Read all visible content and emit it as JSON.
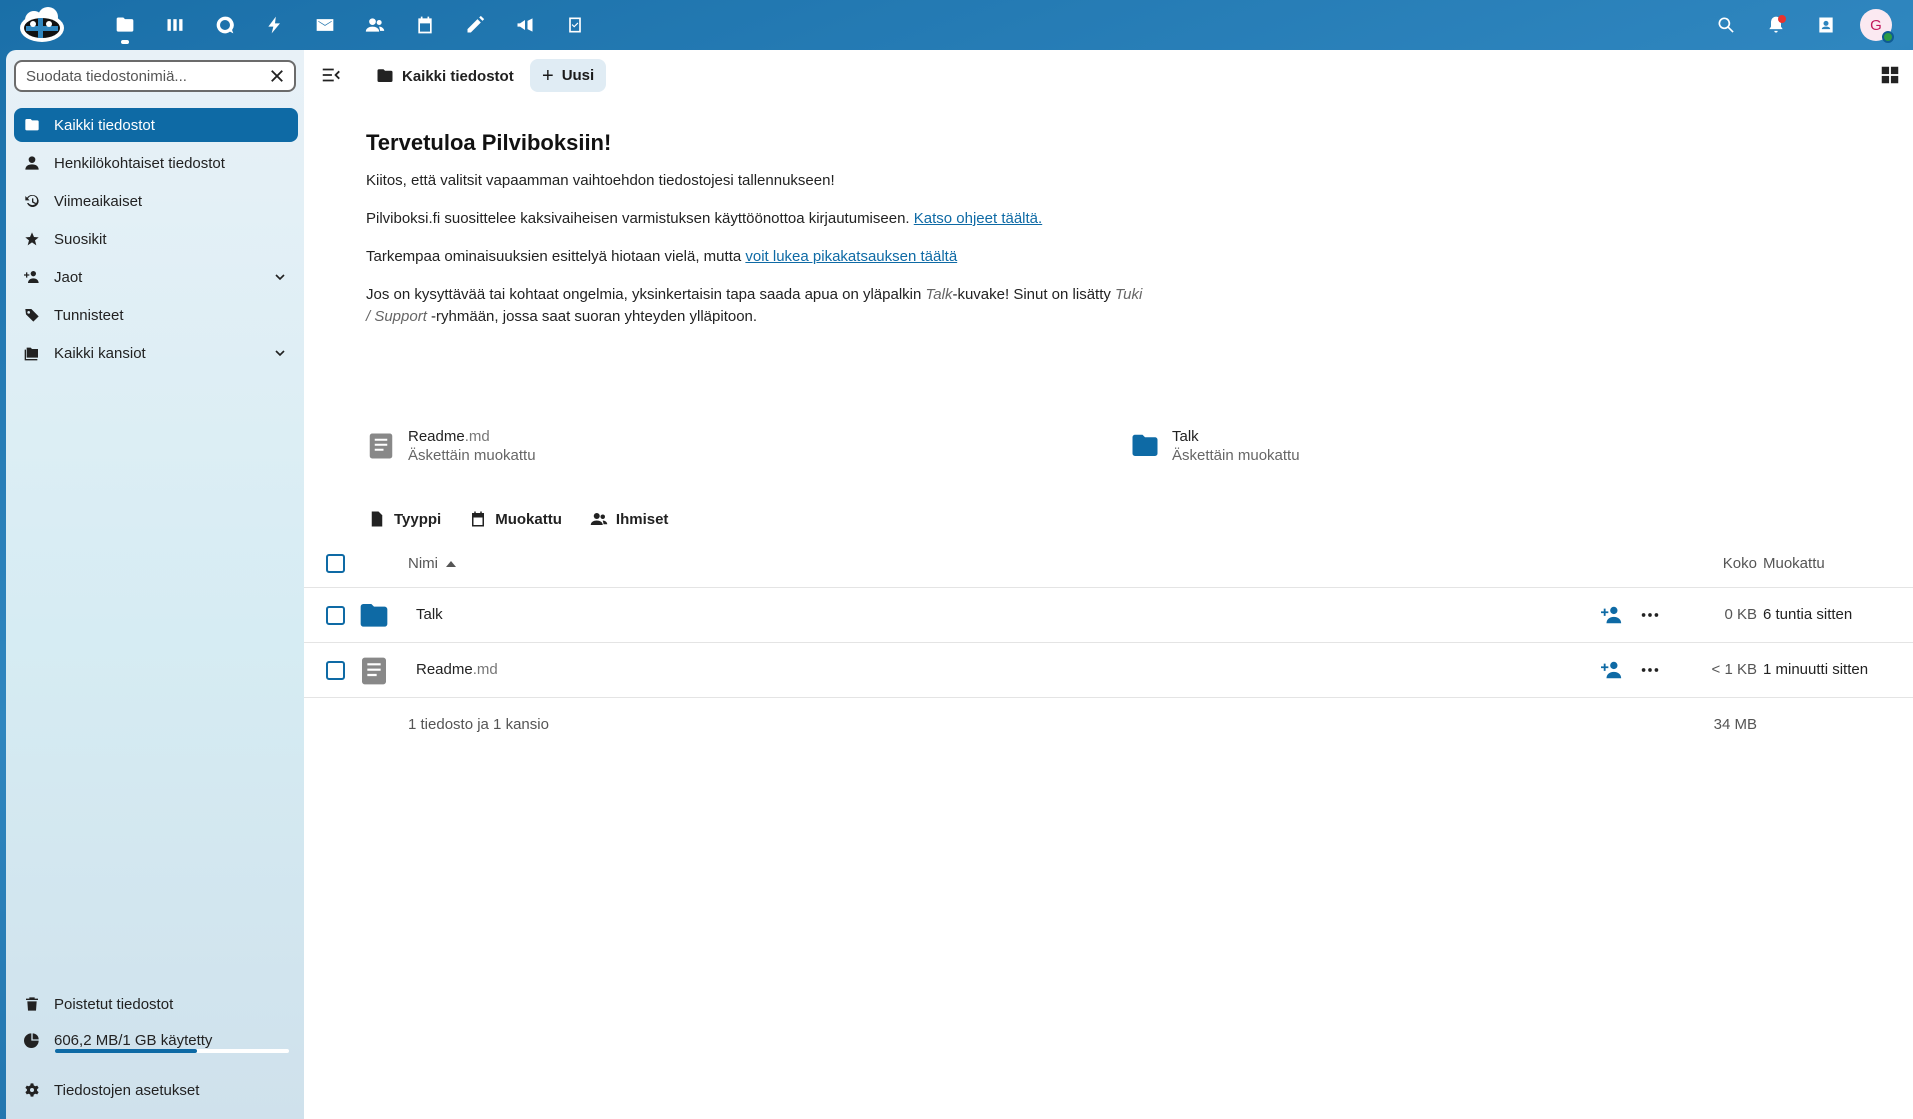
{
  "colors": {
    "topbar": "#0e5b93",
    "primary": "#0e6aa5",
    "sidebar": "#dcecf3"
  },
  "topbar": {
    "apps": [
      {
        "icon": "files-icon"
      },
      {
        "icon": "activity-icon"
      },
      {
        "icon": "talk-icon"
      },
      {
        "icon": "flash-icon"
      },
      {
        "icon": "mail-icon"
      },
      {
        "icon": "contacts-icon"
      },
      {
        "icon": "calendar-icon"
      },
      {
        "icon": "notes-icon"
      },
      {
        "icon": "announcements-icon"
      },
      {
        "icon": "tasks-icon"
      }
    ],
    "avatar_initial": "G"
  },
  "sidebar": {
    "filter_placeholder": "Suodata tiedostonimiä...",
    "items": [
      {
        "label": "Kaikki tiedostot",
        "icon": "folder-icon"
      },
      {
        "label": "Henkilökohtaiset tiedostot",
        "icon": "person-icon"
      },
      {
        "label": "Viimeaikaiset",
        "icon": "history-icon"
      },
      {
        "label": "Suosikit",
        "icon": "star-icon"
      },
      {
        "label": "Jaot",
        "icon": "share-icon"
      },
      {
        "label": "Tunnisteet",
        "icon": "tag-icon"
      },
      {
        "label": "Kaikki kansiot",
        "icon": "folders-icon"
      }
    ],
    "deleted_label": "Poistetut tiedostot",
    "quota_label": "606,2 MB/1 GB käytetty",
    "quota_fraction": 0.606,
    "settings_label": "Tiedostojen asetukset"
  },
  "header": {
    "breadcrumb": "Kaikki tiedostot",
    "new_label": "Uusi"
  },
  "welcome": {
    "title": "Tervetuloa Pilviboksiin!",
    "p1": "Kiitos, että valitsit vapaamman vaihtoehdon tiedostojesi tallennukseen!",
    "p2_text": "Pilviboksi.fi suosittelee kaksivaiheisen varmistuksen käyttöönottoa kirjautumiseen. ",
    "p2_link": "Katso ohjeet täältä.",
    "p3_text": "Tarkempaa ominaisuuksien esittelyä hiotaan vielä, mutta ",
    "p3_link": "voit lukea pikakatsauksen täältä",
    "p4_a": "Jos on kysyttävää tai kohtaat ongelmia, yksinkertaisin tapa saada apua on yläpalkin ",
    "p4_talk": "Talk",
    "p4_b": "-kuvake! Sinut on lisätty ",
    "p4_group": "Tuki / Support",
    "p4_c": " -ryhmään, jossa saat suoran yhteyden ylläpitoon."
  },
  "recent": [
    {
      "name": "Readme",
      "ext": ".md",
      "sub": "Äskettäin muokattu"
    },
    {
      "name": "Talk",
      "ext": "",
      "sub": "Äskettäin muokattu"
    }
  ],
  "filters": [
    {
      "label": "Tyyppi"
    },
    {
      "label": "Muokattu"
    },
    {
      "label": "Ihmiset"
    }
  ],
  "table": {
    "col_name": "Nimi",
    "col_size": "Koko",
    "col_modified": "Muokattu",
    "rows": [
      {
        "name": "Talk",
        "ext": "",
        "size": "0 KB",
        "modified": "6 tuntia sitten"
      },
      {
        "name": "Readme",
        "ext": ".md",
        "size": "< 1 KB",
        "modified": "1 minuutti sitten"
      }
    ],
    "summary": "1 tiedosto ja 1 kansio",
    "total_size": "34 MB"
  }
}
